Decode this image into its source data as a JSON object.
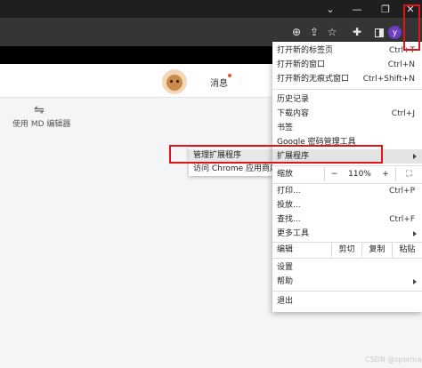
{
  "window": {
    "minimize_icon": "chevron-down-icon",
    "restore_icon": "restore-icon",
    "close_icon": "close-icon",
    "minimize_glyph": "⌄",
    "maximize_glyph": "—",
    "restore_glyph": "❐",
    "close_glyph": "✕"
  },
  "toolbar": {
    "zoom_glyph": "⊕",
    "share_glyph": "⇪",
    "star_glyph": "☆",
    "extensions_glyph": "✚",
    "profile_letter": "y",
    "menu_glyph": "⋮"
  },
  "page": {
    "messages_label": "消息",
    "md_switch_glyph": "⇋",
    "md_editor_label": "使用 MD 编辑器"
  },
  "menu": {
    "new_tab": {
      "label": "打开新的标签页",
      "shortcut": "Ctrl+T"
    },
    "new_window": {
      "label": "打开新的窗口",
      "shortcut": "Ctrl+N"
    },
    "incognito": {
      "label": "打开新的无痕式窗口",
      "shortcut": "Ctrl+Shift+N"
    },
    "history": {
      "label": "历史记录"
    },
    "downloads": {
      "label": "下载内容",
      "shortcut": "Ctrl+J"
    },
    "bookmarks": {
      "label": "书签"
    },
    "password_manager": {
      "label": "Google 密码管理工具"
    },
    "extensions": {
      "label": "扩展程序"
    },
    "zoom": {
      "label": "缩放",
      "minus": "−",
      "value": "110%",
      "plus": "+",
      "fullscreen_glyph": "⛶"
    },
    "print": {
      "label": "打印...",
      "shortcut": "Ctrl+P"
    },
    "cast": {
      "label": "投放..."
    },
    "find": {
      "label": "查找...",
      "shortcut": "Ctrl+F"
    },
    "more_tools": {
      "label": "更多工具"
    },
    "edit": {
      "label": "编辑",
      "cut": "剪切",
      "copy": "复制",
      "paste": "粘贴"
    },
    "settings": {
      "label": "设置"
    },
    "help": {
      "label": "帮助"
    },
    "exit": {
      "label": "退出"
    }
  },
  "submenu": {
    "manage_extensions": "管理扩展程序",
    "chrome_web_store": "访问 Chrome 应用商店"
  },
  "watermark": "CSDN @sperma",
  "colors": {
    "highlight_red": "#e0151a",
    "profile_purple": "#6b3fc4"
  }
}
